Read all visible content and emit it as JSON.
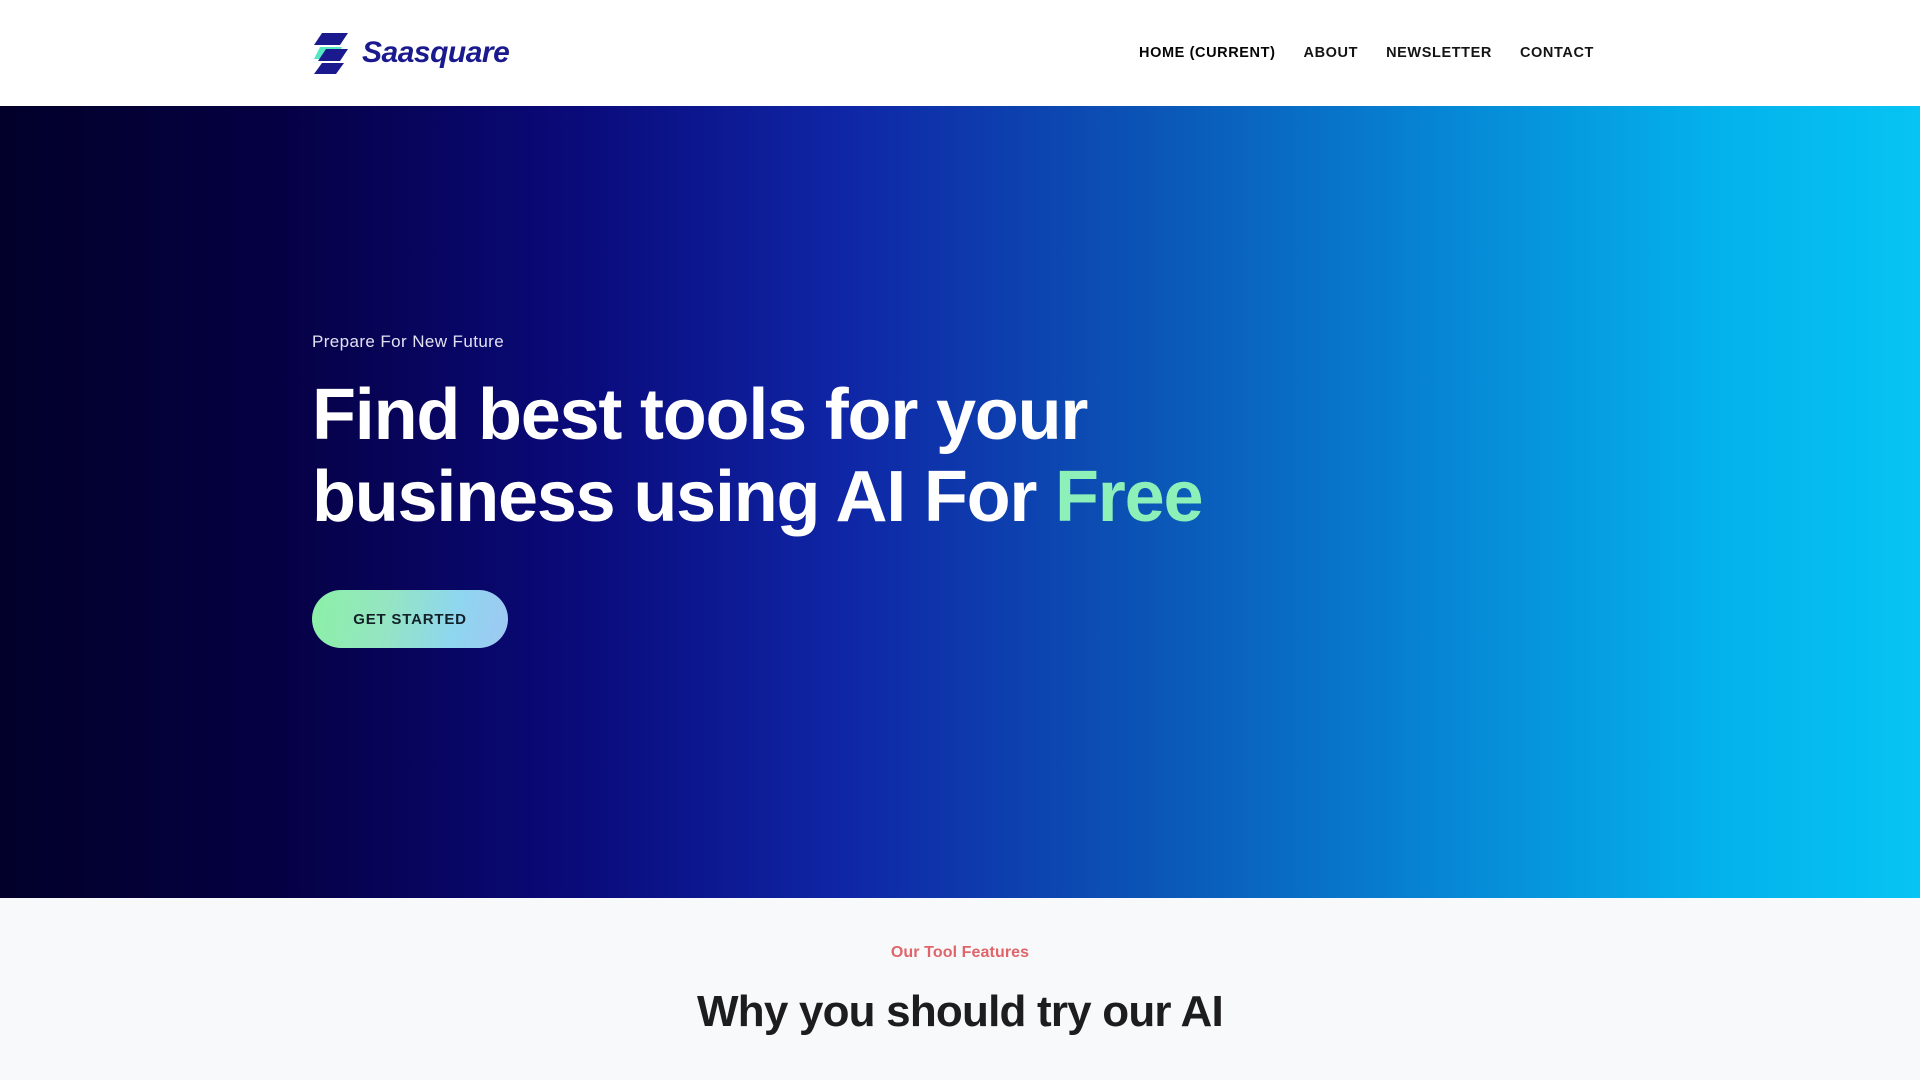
{
  "header": {
    "brand": {
      "name": "Saasquare",
      "mark_icon": "stacked-slanted-bars-logo-icon",
      "mark_color_dark": "#1a1a8e",
      "mark_color_accent": "#55e8c0"
    },
    "nav": [
      {
        "label": "HOME (CURRENT)",
        "current": true
      },
      {
        "label": "ABOUT",
        "current": false
      },
      {
        "label": "NEWSLETTER",
        "current": false
      },
      {
        "label": "CONTACT",
        "current": false
      }
    ]
  },
  "hero": {
    "eyebrow": "Prepare For New Future",
    "title_line1": "Find best tools for your",
    "title_line2_prefix": "business using AI For ",
    "title_accent": "Free",
    "cta_label": "GET STARTED",
    "accent_color": "#8df0b9",
    "gradient_start": "#02002a",
    "gradient_end": "#06c4f4",
    "cta_gradient_start": "#8cf0a6",
    "cta_gradient_end": "#9fc8f2"
  },
  "features": {
    "eyebrow": "Our Tool Features",
    "eyebrow_color": "#e0656a",
    "title": "Why you should try our AI",
    "background": "#f8f9fb"
  }
}
